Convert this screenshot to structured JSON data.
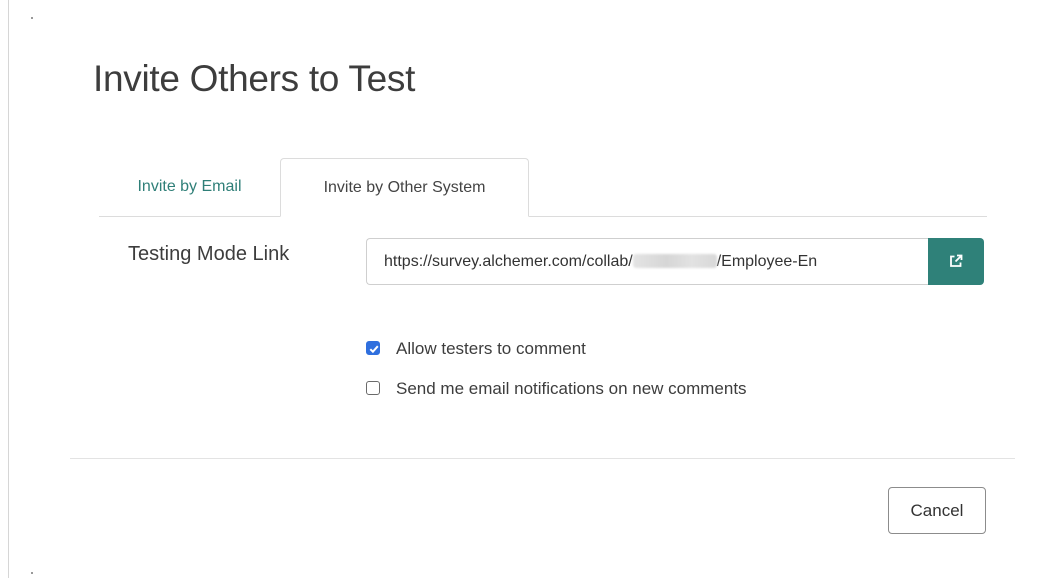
{
  "dialog": {
    "title": "Invite Others to Test"
  },
  "tabs": [
    {
      "label": "Invite by Email",
      "active": false
    },
    {
      "label": "Invite by Other System",
      "active": true
    }
  ],
  "testing_link": {
    "label": "Testing Mode Link",
    "value_prefix": "https://survey.alchemer.com/collab/",
    "value_suffix": "/Employee-En",
    "open_icon": "external-link-icon"
  },
  "options": [
    {
      "label": "Allow testers to comment",
      "checked": true
    },
    {
      "label": "Send me email notifications on new comments",
      "checked": false
    }
  ],
  "footer": {
    "cancel_label": "Cancel"
  },
  "colors": {
    "accent": "#2f8179",
    "tab_link": "#2f7f78",
    "checkbox_checked": "#2f6fde"
  }
}
